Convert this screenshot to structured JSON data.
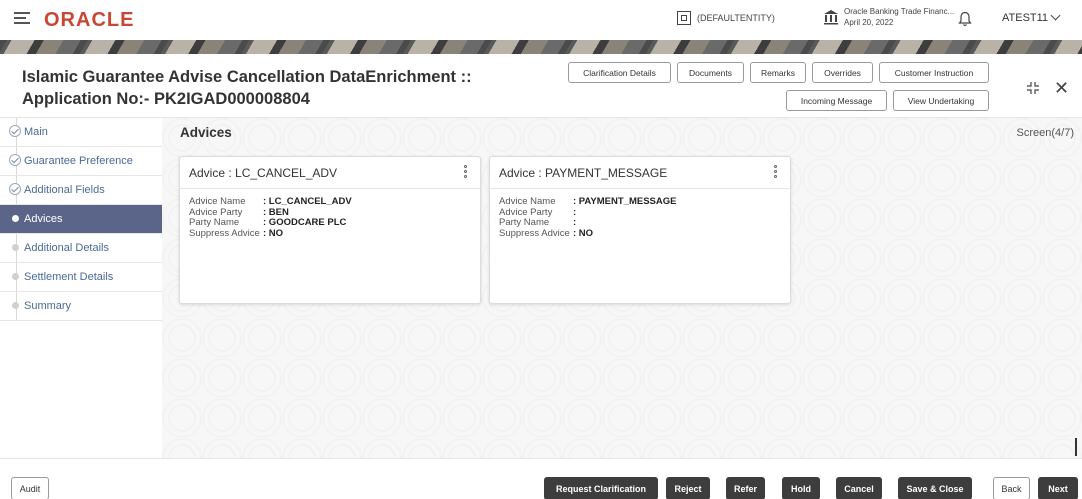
{
  "topbar": {
    "logo": "ORACLE",
    "entity": "(DEFAULTENTITY)",
    "bank_name": "Oracle Banking Trade Financ...",
    "bank_date": "April 20, 2022",
    "user": "ATEST11"
  },
  "header": {
    "title_line1": "Islamic Guarantee Advise Cancellation DataEnrichment ::",
    "title_line2": "Application No:- PK2IGAD000008804",
    "buttons": {
      "clarification_details": "Clarification Details",
      "documents": "Documents",
      "remarks": "Remarks",
      "overrides": "Overrides",
      "customer_instruction": "Customer Instruction",
      "incoming_message": "Incoming Message",
      "view_undertaking": "View Undertaking"
    }
  },
  "sidebar": {
    "items": [
      {
        "label": "Main",
        "state": "done"
      },
      {
        "label": "Guarantee Preference",
        "state": "done"
      },
      {
        "label": "Additional Fields",
        "state": "done"
      },
      {
        "label": "Advices",
        "state": "active"
      },
      {
        "label": "Additional Details",
        "state": "pending"
      },
      {
        "label": "Settlement Details",
        "state": "pending"
      },
      {
        "label": "Summary",
        "state": "pending"
      }
    ]
  },
  "main": {
    "section_title": "Advices",
    "screen_indicator": "Screen(4/7)",
    "cards": [
      {
        "title": "Advice : LC_CANCEL_ADV",
        "fields": [
          {
            "label": "Advice Name",
            "value": ": LC_CANCEL_ADV"
          },
          {
            "label": "Advice Party",
            "value": ": BEN"
          },
          {
            "label": "Party Name",
            "value": ": GOODCARE PLC"
          },
          {
            "label": "Suppress Advice",
            "value": ": NO"
          }
        ]
      },
      {
        "title": "Advice : PAYMENT_MESSAGE",
        "fields": [
          {
            "label": "Advice Name",
            "value": ": PAYMENT_MESSAGE"
          },
          {
            "label": "Advice Party",
            "value": ":"
          },
          {
            "label": "Party Name",
            "value": ":"
          },
          {
            "label": "Suppress Advice",
            "value": ": NO"
          }
        ]
      }
    ]
  },
  "footer": {
    "audit": "Audit",
    "request_clarification": "Request Clarification",
    "reject": "Reject",
    "refer": "Refer",
    "hold": "Hold",
    "cancel": "Cancel",
    "save_close": "Save & Close",
    "back": "Back",
    "next": "Next"
  },
  "colors": {
    "brand": "#c74634",
    "nav_active": "#5b6589",
    "nav_text": "#4a6a96",
    "button_dark": "#3d3d3d"
  }
}
